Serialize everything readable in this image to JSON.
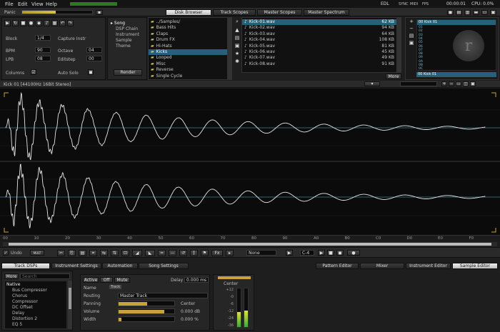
{
  "menu": [
    "File",
    "Edit",
    "View",
    "Help"
  ],
  "status": {
    "cpu": "CPU: 0.0%",
    "time": "00:00:01",
    "sync": "SYNC",
    "midi": "MIDI",
    "fps": "FPS",
    "lbl": "EDL"
  },
  "panic": "Panic",
  "vu_level": 0.48,
  "top_tabs": [
    "Disk Browser",
    "Track Scopes",
    "Master Scopes",
    "Master Spectrum"
  ],
  "active_top_tab": 0,
  "song": {
    "block_label": "Block",
    "block_value": "1/4",
    "capture": "Capture Instr",
    "bpm_label": "BPM",
    "bpm_value": "90",
    "octave_label": "Octave",
    "octave_value": "04",
    "lpb_label": "LPB",
    "lpb_value": "08",
    "editstep_label": "Editstep",
    "editstep_value": "00",
    "columns_label": "Columns",
    "autosolo_label": "Auto Solo"
  },
  "browser": {
    "categories": [
      "Song",
      "DSP Chain",
      "Instrument",
      "Sample",
      "Theme"
    ],
    "render": "Render",
    "folders": [
      "../Samples/",
      "Bass Hits",
      "Claps",
      "Drum FX",
      "Hi-Hats",
      "Kicks",
      "Looped",
      "Misc",
      "Reverse",
      "Single Cycle"
    ],
    "selected_folder": 5,
    "files": [
      {
        "name": "Kick-01.wav",
        "size": "62 KB"
      },
      {
        "name": "Kick-02.wav",
        "size": "94 KB"
      },
      {
        "name": "Kick-03.wav",
        "size": "64 KB"
      },
      {
        "name": "Kick-04.wav",
        "size": "108 KB"
      },
      {
        "name": "Kick-05.wav",
        "size": "81 KB"
      },
      {
        "name": "Kick-06.wav",
        "size": "45 KB"
      },
      {
        "name": "Kick-07.wav",
        "size": "49 KB"
      },
      {
        "name": "Kick-08.wav",
        "size": "91 KB"
      }
    ],
    "selected_file": 0,
    "more": "More"
  },
  "instr_list": {
    "title": "00 Kick 01",
    "items": [
      "01",
      "02",
      "03",
      "04",
      "05",
      "06",
      "07",
      "08",
      "09",
      "0A",
      "0B",
      "0C"
    ],
    "sample_name": "00 Kick 01"
  },
  "sample_header": "Kick 01 [44100Hz 16Bit Stereo]",
  "ruler": [
    "00",
    "10",
    "20",
    "30",
    "40",
    "50",
    "60",
    "70",
    "80",
    "90",
    "A0",
    "B0",
    "C0",
    "D0",
    "E0",
    "F0"
  ],
  "bottom_bar": {
    "undo": "Undo",
    "none": "None",
    "value": "C-4",
    "mode": "MULT"
  },
  "bottom_tabs_left": [
    "Track DSPs",
    "Instrument Settings",
    "Automation",
    "Song Settings"
  ],
  "active_left_tab": 0,
  "bottom_tabs_right": [
    "Pattern Editor",
    "Mixer",
    "Instrument Editor",
    "Sample Editor"
  ],
  "active_right_tab": 3,
  "dsp": {
    "more": "More",
    "search": "Search",
    "header": "Native",
    "items": [
      "Bus Compressor",
      "Chorus",
      "Compressor",
      "DC Offset",
      "Delay",
      "Distortion 2",
      "EQ 5"
    ]
  },
  "track": {
    "active": "Active",
    "off": "Off",
    "mute": "Mute",
    "delay_label": "Delay",
    "delay_value": "0.000 ms",
    "name_label": "Name",
    "routing_label": "Routing",
    "routing_value": "Master Track",
    "panning_label": "Panning",
    "panning_value": "Center",
    "volume_label": "Volume",
    "volume_value": "0.000 dB",
    "width_label": "Width",
    "width_value": "0.000 %",
    "title_label": "Track"
  },
  "meter": {
    "center": "Center",
    "scale": [
      "+12",
      "-0",
      "-6",
      "-12",
      "-24",
      "-36"
    ],
    "level_l": 0.38,
    "level_r": 0.42
  }
}
